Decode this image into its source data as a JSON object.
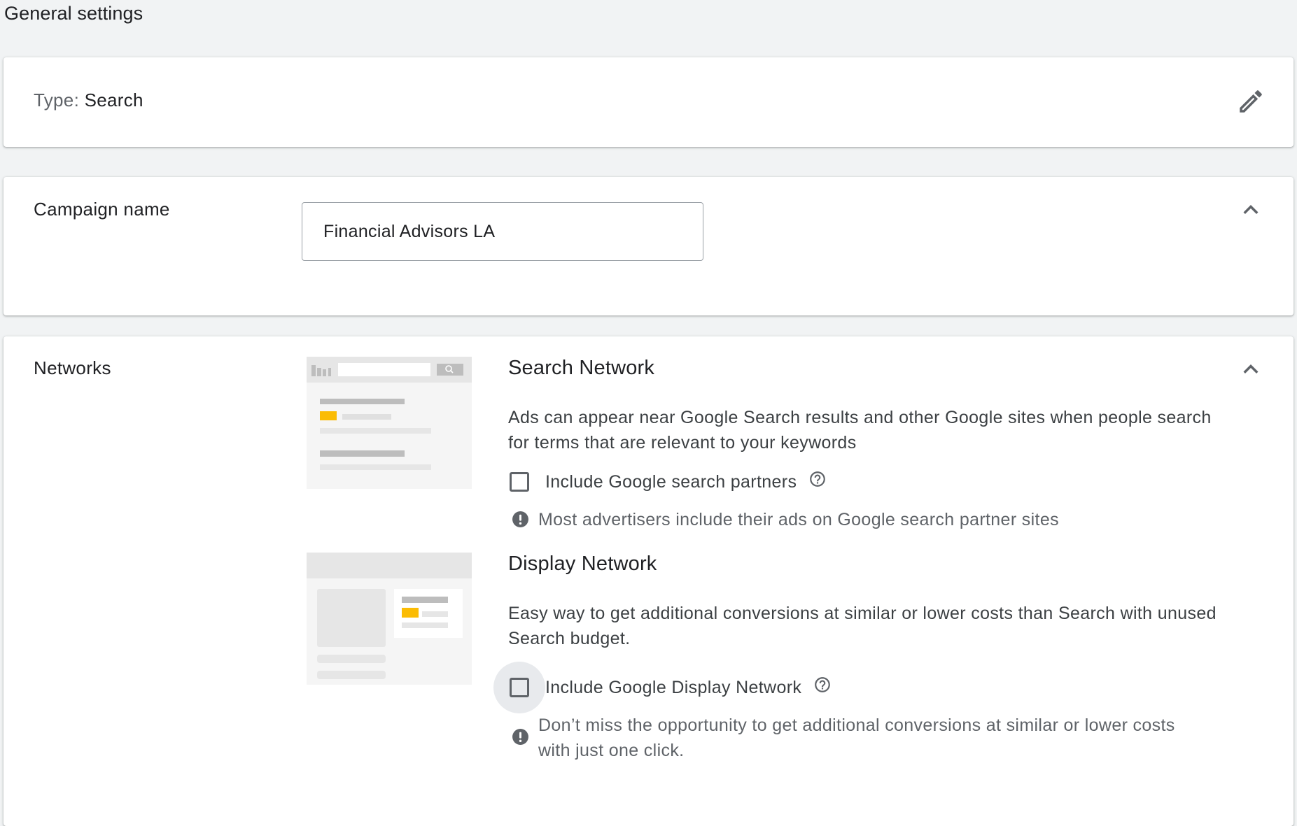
{
  "page": {
    "title": "General settings"
  },
  "type_card": {
    "label": "Type:",
    "value": "Search",
    "edit_icon": "pencil-icon"
  },
  "campaign_name": {
    "label": "Campaign name",
    "value": "Financial Advisors LA",
    "collapse_icon": "chevron-up-icon"
  },
  "networks": {
    "label": "Networks",
    "collapse_icon": "chevron-up-icon",
    "search": {
      "title": "Search Network",
      "description": "Ads can appear near Google Search results and other Google sites when people search for terms that are relevant to your keywords",
      "checkbox_label": "Include Google search partners",
      "checked": false,
      "help_icon": "help-circle-icon",
      "notice": "Most advertisers include their ads on Google search partner sites",
      "notice_icon": "exclamation-circle-icon"
    },
    "display": {
      "title": "Display Network",
      "description": "Easy way to get additional conversions at similar or lower costs than Search with unused Search budget.",
      "checkbox_label": "Include Google Display Network",
      "checked": false,
      "help_icon": "help-circle-icon",
      "notice": "Don’t miss the opportunity to get additional conversions at similar or lower costs with just one click.",
      "notice_icon": "exclamation-circle-icon"
    }
  },
  "colors": {
    "background": "#f1f3f4",
    "card": "#ffffff",
    "text_primary": "#202124",
    "text_secondary": "#5f6368",
    "illustration_accent": "#fbbc04"
  }
}
